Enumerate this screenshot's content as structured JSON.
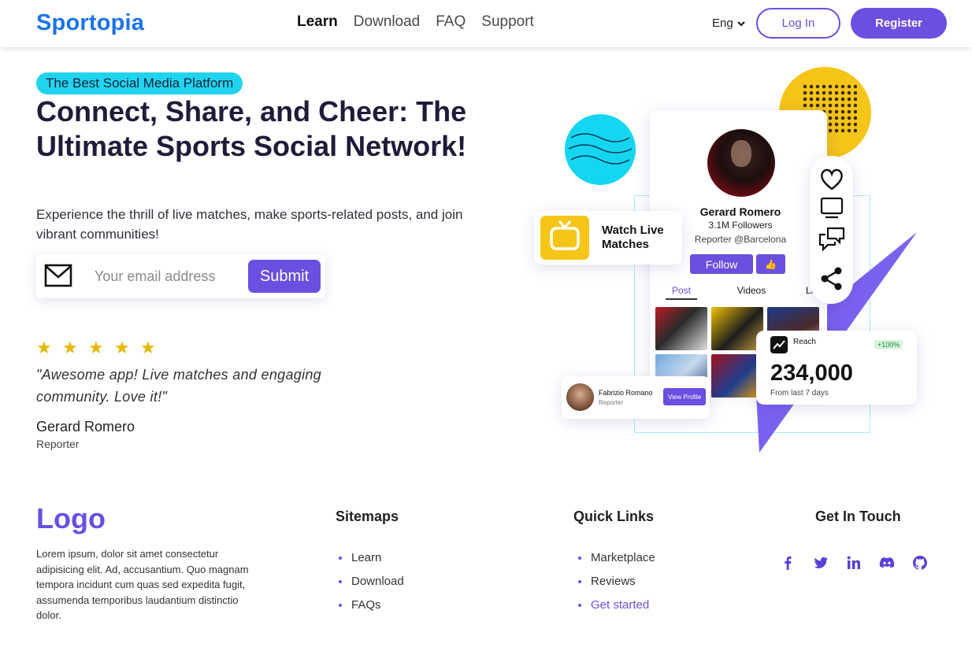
{
  "header": {
    "brand": "Sportopia",
    "nav": [
      "Learn",
      "Download",
      "FAQ",
      "Support"
    ],
    "active_nav": "Learn",
    "language": "Eng",
    "login_label": "Log In",
    "register_label": "Register"
  },
  "hero": {
    "tagline": "The Best Social Media Platform",
    "title": "Connect, Share, and Cheer: The Ultimate Sports Social Network!",
    "subtitle": "Experience the thrill of live matches, make sports-related posts, and join vibrant communities!",
    "email_placeholder": "Your email address",
    "submit_label": "Submit"
  },
  "testimonial": {
    "rating": 5,
    "quote": "\"Awesome app! Live matches and engaging community. Love it!\"",
    "name": "Gerard Romero",
    "role": "Reporter"
  },
  "illustration": {
    "profile": {
      "name": "Gerard Romero",
      "followers": "3.1M Followers",
      "role": "Reporter @Barcelona",
      "follow_label": "Follow",
      "tabs": [
        "Post",
        "Videos",
        "Live"
      ],
      "active_tab": "Post"
    },
    "watch_card": {
      "label": "Watch Live Matches"
    },
    "reach_card": {
      "label": "Reach",
      "badge": "+100%",
      "value": "234,000",
      "sub": "From last 7 days"
    },
    "reporter_card": {
      "name": "Fabrizio Romano",
      "role": "Reporter",
      "button": "View Profile"
    },
    "side_icons": [
      "heart-icon",
      "tv-icon",
      "chat-icon",
      "share-icon"
    ]
  },
  "footer": {
    "logo": "Logo",
    "about": "Lorem ipsum, dolor sit amet consectetur adipisicing elit. Ad, accusantium. Quo magnam tempora incidunt cum quas sed expedita fugit, assumenda temporibus laudantium distinctio dolor.",
    "sitemaps": {
      "heading": "Sitemaps",
      "items": [
        "Learn",
        "Download",
        "FAQs"
      ]
    },
    "quick_links": {
      "heading": "Quick Links",
      "items": [
        "Marketplace",
        "Reviews",
        "Get started"
      ]
    },
    "get_in_touch": {
      "heading": "Get In Touch",
      "icons": [
        "facebook-icon",
        "twitter-icon",
        "linkedin-icon",
        "discord-icon",
        "github-icon"
      ]
    }
  },
  "colors": {
    "brand_blue": "#1a73e8",
    "accent_purple": "#6a4fe0",
    "cyan": "#22d3ee",
    "yellow": "#f5c518"
  }
}
